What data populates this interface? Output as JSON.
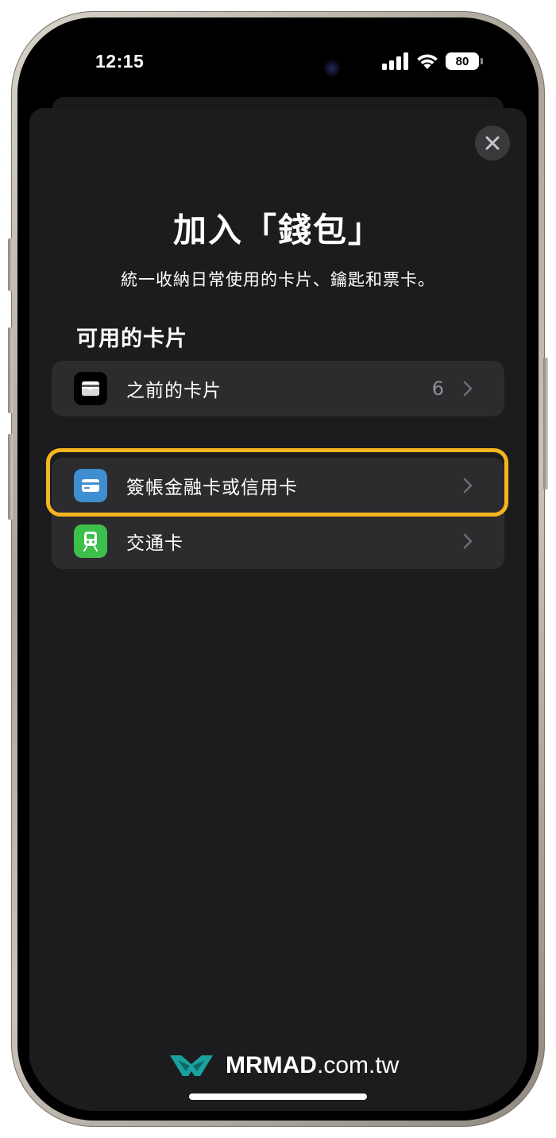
{
  "status_bar": {
    "time": "12:15",
    "battery": "80",
    "signal_icon": "cellular-signal-icon",
    "wifi_icon": "wifi-icon"
  },
  "sheet": {
    "title": "加入「錢包」",
    "subtitle": "統一收納日常使用的卡片、鑰匙和票卡。",
    "close_icon": "close-icon"
  },
  "available_cards": {
    "heading": "可用的卡片",
    "previous": {
      "label": "之前的卡片",
      "count": "6",
      "icon": "wallet-icon"
    }
  },
  "add_options": [
    {
      "label": "簽帳金融卡或信用卡",
      "icon": "credit-card-icon",
      "icon_color": "#3e8ed0",
      "highlighted": true
    },
    {
      "label": "交通卡",
      "icon": "train-icon",
      "icon_color": "#3dbf4c",
      "highlighted": false
    }
  ],
  "highlight_color": "#f6b51f",
  "watermark": {
    "brand": "MRMAD",
    "domain": ".com.tw",
    "logo_color": "#1aa2a0"
  }
}
